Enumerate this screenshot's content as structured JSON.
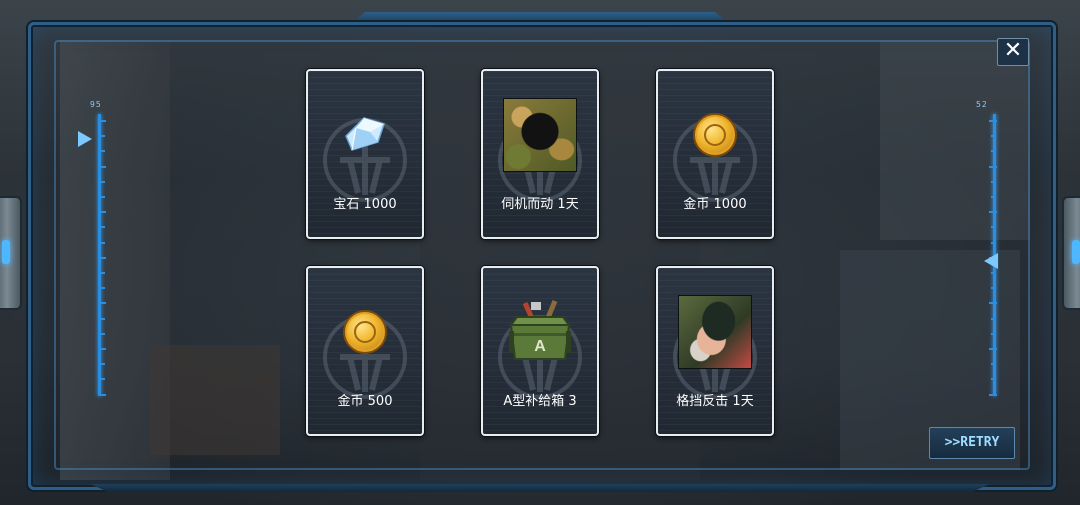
{
  "gauges": {
    "left": {
      "value": "95",
      "pointer_level": 0.91
    },
    "right": {
      "value": "52",
      "pointer_level": 0.48
    }
  },
  "buttons": {
    "close_icon": "close-icon",
    "retry_label": ">>RETRY"
  },
  "rewards": [
    {
      "label": "宝石 1000",
      "icon": "gem-icon"
    },
    {
      "label": "伺机而动 1天",
      "icon": "ninja-portrait-icon"
    },
    {
      "label": "金币 1000",
      "icon": "gold-coin-icon"
    },
    {
      "label": "金币 500",
      "icon": "gold-coin-icon"
    },
    {
      "label": "A型补给箱 3",
      "icon": "supply-crate-icon"
    },
    {
      "label": "格挡反击 1天",
      "icon": "fighter-portrait-icon"
    }
  ],
  "colors": {
    "frame_blue": "#2f5f86",
    "gauge_blue": "#2a8fe0",
    "card_border": "#e8edf0",
    "retry_text": "#9fdcff",
    "coin_gold": "#f0b52b"
  }
}
